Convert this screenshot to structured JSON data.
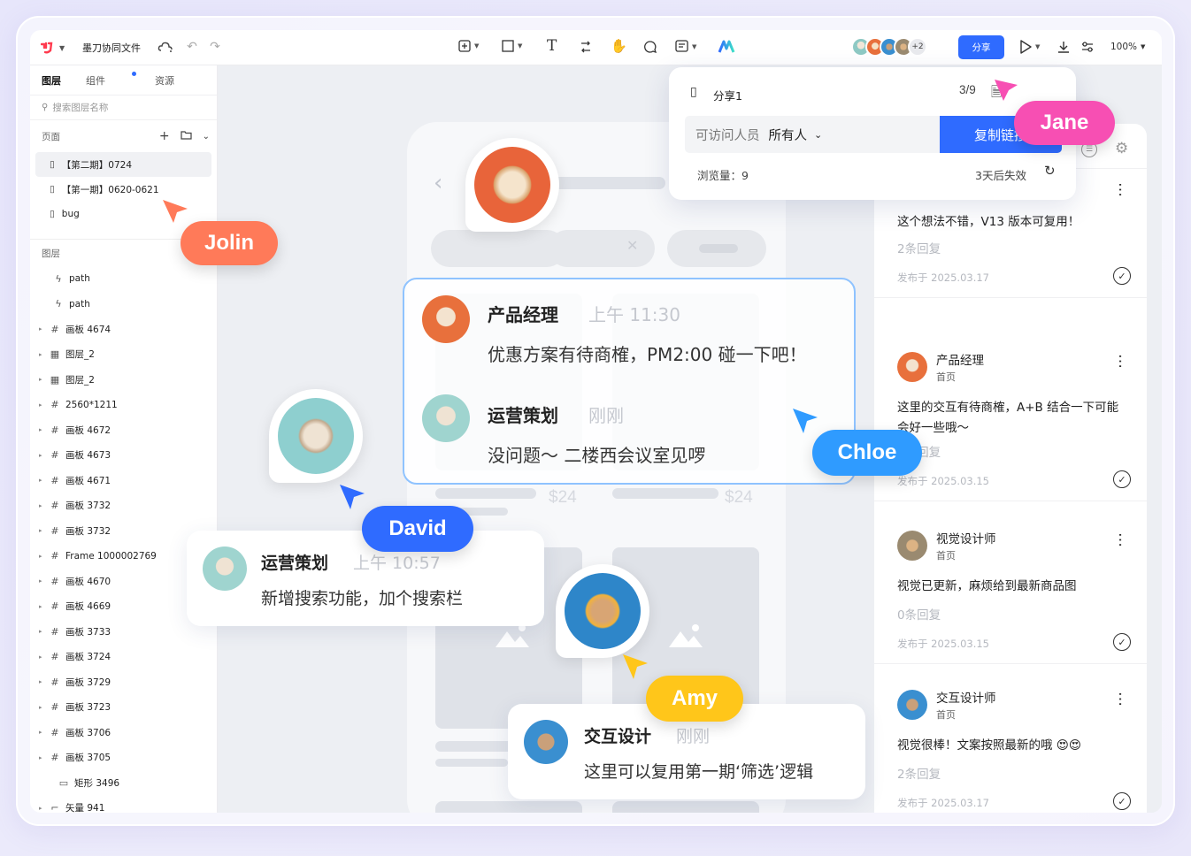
{
  "app": {
    "doc_title": "墨刀协同文件",
    "logo": "moda-logo",
    "zoom": "100%",
    "share_label": "分享",
    "avatars_more": "+2"
  },
  "sidebar": {
    "tabs": [
      "图层",
      "组件",
      "资源"
    ],
    "search_placeholder": "搜索图层名称",
    "pages_label": "页面",
    "pages": [
      "【第二期】0724",
      "【第一期】0620-0621",
      "bug"
    ],
    "layers_label": "图层",
    "layers": [
      {
        "name": "path",
        "icon": "path-icon",
        "caret": false
      },
      {
        "name": "path",
        "icon": "path-icon",
        "caret": false
      },
      {
        "name": "画板 4674",
        "icon": "frame-icon",
        "caret": true
      },
      {
        "name": "图层_2",
        "icon": "image-icon",
        "caret": true
      },
      {
        "name": "图层_2",
        "icon": "image-icon",
        "caret": true
      },
      {
        "name": "2560*1211",
        "icon": "frame-icon",
        "caret": true
      },
      {
        "name": "画板 4672",
        "icon": "frame-icon",
        "caret": true
      },
      {
        "name": "画板 4673",
        "icon": "frame-icon",
        "caret": true
      },
      {
        "name": "画板 4671",
        "icon": "frame-icon",
        "caret": true
      },
      {
        "name": "画板 3732",
        "icon": "frame-icon",
        "caret": true
      },
      {
        "name": "画板 3732",
        "icon": "frame-icon",
        "caret": true
      },
      {
        "name": "Frame 1000002769",
        "icon": "frame-icon",
        "caret": true
      },
      {
        "name": "画板 4670",
        "icon": "frame-icon",
        "caret": true
      },
      {
        "name": "画板 4669",
        "icon": "frame-icon",
        "caret": true
      },
      {
        "name": "画板 3733",
        "icon": "frame-icon",
        "caret": true
      },
      {
        "name": "画板 3724",
        "icon": "frame-icon",
        "caret": true
      },
      {
        "name": "画板 3729",
        "icon": "frame-icon",
        "caret": true
      },
      {
        "name": "画板 3723",
        "icon": "frame-icon",
        "caret": true
      },
      {
        "name": "画板 3706",
        "icon": "frame-icon",
        "caret": true
      },
      {
        "name": "画板 3705",
        "icon": "frame-icon",
        "caret": true
      },
      {
        "name": "矩形 3496",
        "icon": "rect-icon",
        "caret": false
      },
      {
        "name": "矢量 941",
        "icon": "vector-icon",
        "caret": true
      }
    ]
  },
  "share_popup": {
    "name": "分享1",
    "count": "3/9",
    "access_label": "可访问人员",
    "access_value": "所有人",
    "copy_label": "复制链接",
    "views": "浏览量：9",
    "expire": "3天后失效"
  },
  "cursors": {
    "jolin": "Jolin",
    "jane": "Jane",
    "chloe": "Chloe",
    "david": "David",
    "amy": "Amy"
  },
  "colors": {
    "jolin": "#ff7a59",
    "jane": "#f74fb3",
    "chloe": "#2f9bff",
    "david": "#2f6bff",
    "amy": "#ffc61a",
    "primary": "#2f6bff"
  },
  "chat1": [
    {
      "author": "产品经理",
      "time": "上午 11:30",
      "text": "优惠方案有待商榷，PM2:00 碰一下吧！"
    },
    {
      "author": "运营策划",
      "time": "刚刚",
      "text": "没问题～ 二楼西会议室见啰"
    }
  ],
  "chat2": {
    "author": "运营策划",
    "time": "上午 10:57",
    "text": "新增搜索功能，加个搜索栏"
  },
  "chat3": {
    "author": "交互设计",
    "time": "刚刚",
    "text": "这里可以复用第一期‘筛选’逻辑"
  },
  "mock": {
    "price1": "$24",
    "price2": "$24"
  },
  "comments": [
    {
      "text": "这个想法不错，V13 版本可复用！",
      "replies": "2条回复",
      "date": "发布于 2025.03.17"
    },
    {
      "author": "产品经理",
      "page": "首页",
      "text": "这里的交互有待商榷，A+B 结合一下可能会好一些哦～",
      "replies": "2条回复",
      "date": "发布于 2025.03.15"
    },
    {
      "author": "视觉设计师",
      "page": "首页",
      "text": "视觉已更新，麻烦给到最新商品图",
      "replies": "0条回复",
      "date": "发布于 2025.03.15"
    },
    {
      "author": "交互设计师",
      "page": "首页",
      "text": "视觉很棒！文案按照最新的哦 😍😍",
      "replies": "2条回复",
      "date": "发布于 2025.03.17"
    }
  ]
}
